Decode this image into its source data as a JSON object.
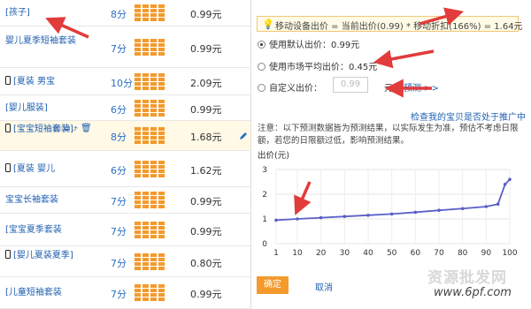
{
  "rows": [
    {
      "name": "[孩子]",
      "score": "8分",
      "price": "0.99元"
    },
    {
      "name": "婴儿夏季短袖套装",
      "score": "7分",
      "price": "0.99元"
    },
    {
      "name": "[夏装 男宝",
      "score": "10分",
      "price": "2.09元",
      "phone": true
    },
    {
      "name": "[婴儿服装]",
      "score": "6分",
      "price": "0.99元"
    },
    {
      "name": "[宝宝短袖套装]",
      "score": "8分",
      "price": "1.68元",
      "phone": true,
      "highlight": true
    },
    {
      "name": "[夏装 婴儿",
      "score": "6分",
      "price": "1.62元",
      "phone": true
    },
    {
      "name": "宝宝长袖套装",
      "score": "7分",
      "price": "0.99元"
    },
    {
      "name": "[宝宝夏季套装",
      "score": "7分",
      "price": "0.99元"
    },
    {
      "name": "[婴儿夏装夏季]",
      "score": "7分",
      "price": "0.80元",
      "phone": true
    },
    {
      "name": "[儿童短袖套装",
      "score": "7分",
      "price": "0.99元"
    }
  ],
  "popup": {
    "tip": "移动设备出价 = 当前出价(0.99) * 移动折扣(166%) = 1.64元",
    "option1": "使用默认出价：0.99元",
    "option2": "使用市场平均出价：0.45元",
    "option3_label": "自定义出价：",
    "option3_value": "0.99",
    "option3_unit": "元",
    "forecast_link": "预测 >>",
    "check_link": "检查我的宝贝是否处于推广中",
    "note": "注意：以下预测数据皆为预测结果，以实际发生为准，预估不考虑日限额，若您的日限额过低，影响预测结果。",
    "chart_ylabel": "出价(元)",
    "ok": "确定",
    "cancel": "取消"
  },
  "chart_data": {
    "type": "line",
    "ylabel": "出价(元)",
    "xlabel": "",
    "xticks": [
      1,
      10,
      20,
      30,
      40,
      50,
      60,
      70,
      80,
      90,
      100
    ],
    "yticks": [
      0,
      1,
      2,
      3
    ],
    "ylim": [
      0,
      3
    ],
    "xlim": [
      1,
      100
    ],
    "series": [
      {
        "x": [
          1,
          10,
          20,
          30,
          40,
          50,
          60,
          70,
          80,
          90,
          95,
          98,
          100
        ],
        "y": [
          0.95,
          1.0,
          1.05,
          1.1,
          1.15,
          1.2,
          1.27,
          1.35,
          1.42,
          1.5,
          1.6,
          2.4,
          2.6
        ]
      }
    ]
  },
  "watermark": {
    "line1": "资源批发网",
    "line2": "www.6pf.com"
  },
  "colors": {
    "accent": "#f39a2b",
    "link": "#1f5fb0",
    "arrow": "#e23b3b"
  }
}
